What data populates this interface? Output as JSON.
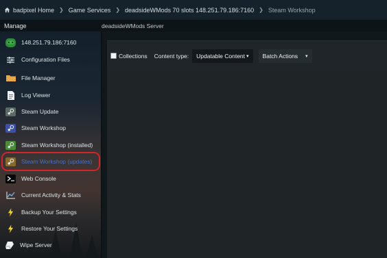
{
  "breadcrumb": [
    "badpixel Home",
    "Game Services",
    "deadsideWMods 70 slots 148.251.79.186:7160",
    "Steam Workshop"
  ],
  "manage_label": "Manage",
  "server_title": "deadsideWMods Server",
  "sidebar": {
    "items": [
      {
        "label": "148.251.79.186:7160",
        "icon": "gamepad-icon"
      },
      {
        "label": "Configuration Files",
        "icon": "sliders-icon"
      },
      {
        "label": "File Manager",
        "icon": "folder-icon"
      },
      {
        "label": "Log Viewer",
        "icon": "document-icon"
      },
      {
        "label": "Steam Update",
        "icon": "steam-icon"
      },
      {
        "label": "Steam Workshop",
        "icon": "steam-icon"
      },
      {
        "label": "Steam Workshop (installed)",
        "icon": "steam-icon"
      },
      {
        "label": "Steam Workshop (updates)",
        "icon": "steam-icon"
      },
      {
        "label": "Web Console",
        "icon": "terminal-icon"
      },
      {
        "label": "Current Activity & Stats",
        "icon": "chart-icon"
      },
      {
        "label": "Backup Your Settings",
        "icon": "bolt-icon"
      },
      {
        "label": "Restore Your Settings",
        "icon": "bolt-icon"
      },
      {
        "label": "Wipe Server",
        "icon": "eraser-icon"
      }
    ],
    "active_item": "Steam Workshop (updates)"
  },
  "toolbar": {
    "collections_label": "Collections",
    "collections_checked": false,
    "content_type_label": "Content type:",
    "content_type_value": "Updatable Content",
    "batch_actions_label": "Batch Actions"
  },
  "colors": {
    "accent_text": "#4a72c8",
    "highlight_ring": "#d4242a",
    "steam_update": "#5b6a63",
    "steam_workshop": "#3f4fa3",
    "steam_installed": "#4b8c3a",
    "steam_updates": "#8a6a2c"
  }
}
